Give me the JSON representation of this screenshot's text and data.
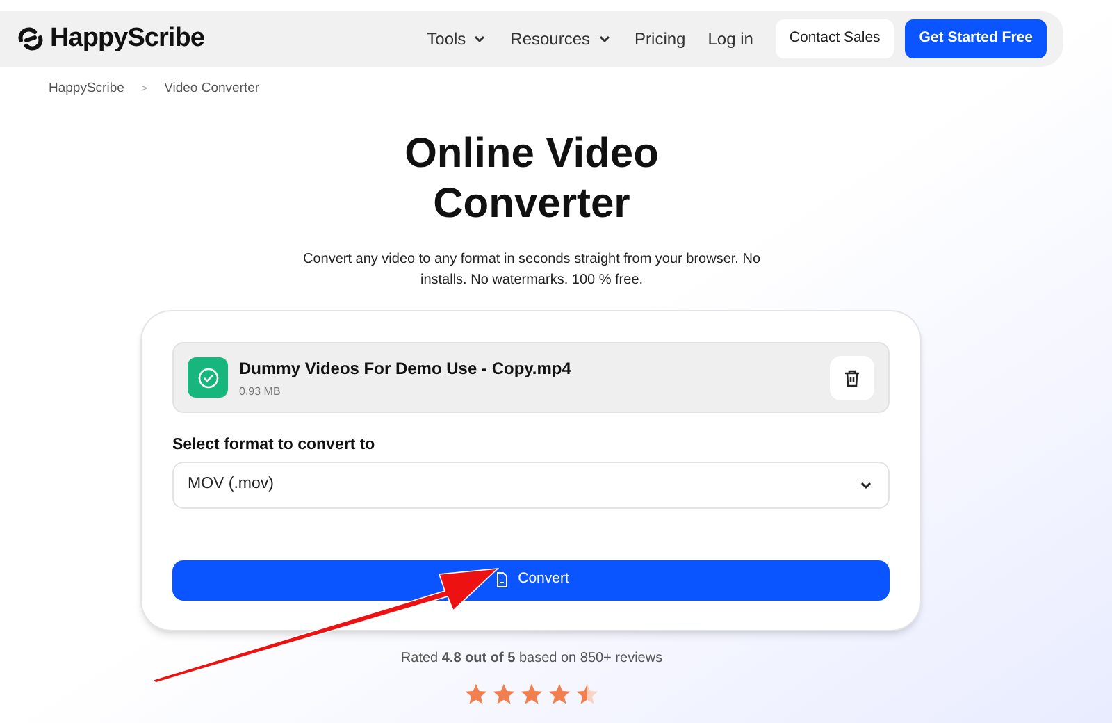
{
  "nav": {
    "logo": "HappyScribe",
    "items": [
      {
        "label": "Tools",
        "dropdown": true
      },
      {
        "label": "Resources",
        "dropdown": true
      },
      {
        "label": "Pricing",
        "dropdown": false
      },
      {
        "label": "Log in",
        "dropdown": false
      }
    ],
    "contact_button": "Contact Sales",
    "cta_button": "Get Started Free"
  },
  "breadcrumb": [
    "HappyScribe",
    "Video Converter"
  ],
  "breadcrumb_separator": ">",
  "title": "Online Video Converter",
  "subtitle": "Convert any video to any format in seconds straight from your browser. No installs. No watermarks. 100 % free.",
  "file": {
    "name": "Dummy Videos For Demo Use - Copy.mp4",
    "size": "0.93 MB",
    "uploaded": true
  },
  "format_label": "Select format to convert to",
  "format_value": "MOV (.mov)",
  "convert_button": "Convert",
  "rating": {
    "text": "Rated **4.8 out of 5** based on 850+ reviews",
    "stars": 4.5
  }
}
